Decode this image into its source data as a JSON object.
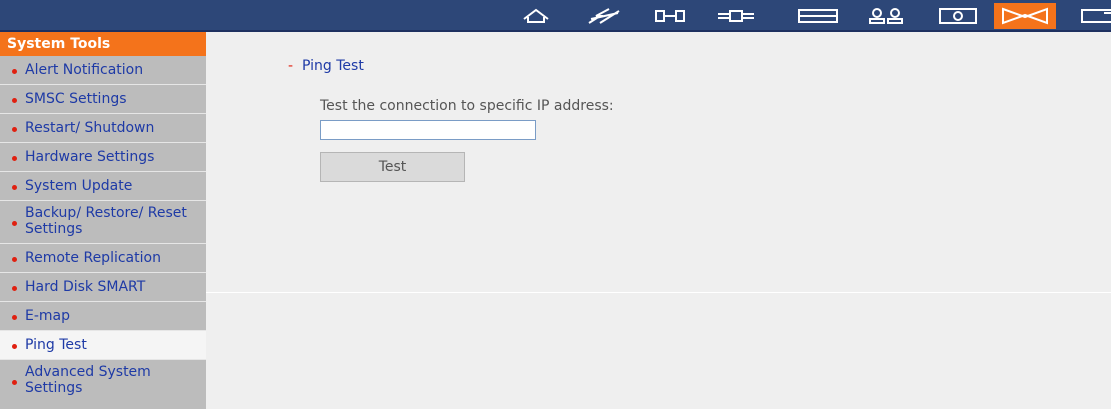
{
  "topnav": {
    "icons": [
      {
        "name": "home-icon",
        "active": false
      },
      {
        "name": "network-icon",
        "active": false
      },
      {
        "name": "device-configuration-icon",
        "active": false
      },
      {
        "name": "network-services-icon",
        "active": false
      },
      {
        "name": "disk-management-icon",
        "active": false
      },
      {
        "name": "access-rights-icon",
        "active": false
      },
      {
        "name": "applications-icon",
        "active": false
      },
      {
        "name": "system-tools-icon",
        "active": true
      },
      {
        "name": "statistics-logs-icon",
        "active": false
      }
    ]
  },
  "sidebar": {
    "title": "System Tools",
    "items": [
      {
        "label": "Alert Notification"
      },
      {
        "label": "SMSC Settings"
      },
      {
        "label": "Restart/ Shutdown"
      },
      {
        "label": "Hardware Settings"
      },
      {
        "label": "System Update"
      },
      {
        "label": "Backup/ Restore/ Reset Settings"
      },
      {
        "label": "Remote Replication"
      },
      {
        "label": "Hard Disk SMART"
      },
      {
        "label": "E-map"
      },
      {
        "label": "Ping Test"
      },
      {
        "label": "Advanced System Settings"
      }
    ],
    "active_item": "Ping Test"
  },
  "main": {
    "section_dash": "-",
    "section_title": "Ping Test",
    "description": "Test the connection to specific IP address:",
    "ip_input": {
      "value": "",
      "placeholder": ""
    },
    "test_button": "Test"
  },
  "colors": {
    "header": "#2d4778",
    "accent": "#f4731b",
    "sidebar": "#bcbcbc",
    "link": "#1e3aa6",
    "bullet": "#e02010"
  }
}
